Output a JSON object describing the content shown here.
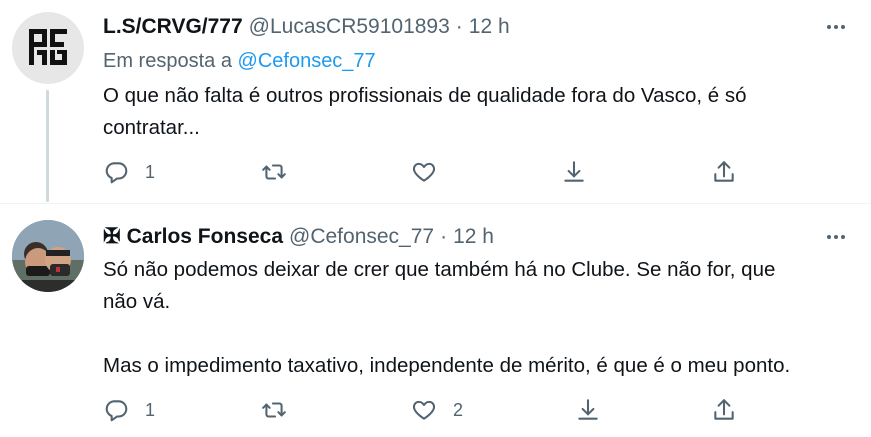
{
  "tweets": [
    {
      "name": "L.S/CRVG/777",
      "handle": "@LucasCR59101893",
      "separator": "·",
      "time": "12 h",
      "reply_prefix": "Em resposta a",
      "reply_handle": "@Cefonsec_77",
      "text_line1": "O que não falta é outros profissionais de qualidade fora do Vasco, é só",
      "text_line2": "contratar...",
      "replies": "1",
      "retweets": "",
      "likes": ""
    },
    {
      "name_prefix": "✠",
      "name": "Carlos Fonseca",
      "handle": "@Cefonsec_77",
      "separator": "·",
      "time": "12 h",
      "text_line1": "Só não podemos deixar de crer que também há no Clube. Se não for, que",
      "text_line2": "não vá.",
      "text_line3": "Mas o impedimento taxativo, independente de mérito, é que é o meu ponto.",
      "replies": "1",
      "retweets": "",
      "likes": "2"
    }
  ],
  "icons": {
    "more": "more-icon",
    "reply": "reply-icon",
    "retweet": "retweet-icon",
    "like": "like-icon",
    "save": "save-icon",
    "share": "share-icon"
  },
  "colors": {
    "text": "#0f1419",
    "secondary": "#536471",
    "link": "#1d9bf0",
    "thread_line": "#cfd9de"
  }
}
